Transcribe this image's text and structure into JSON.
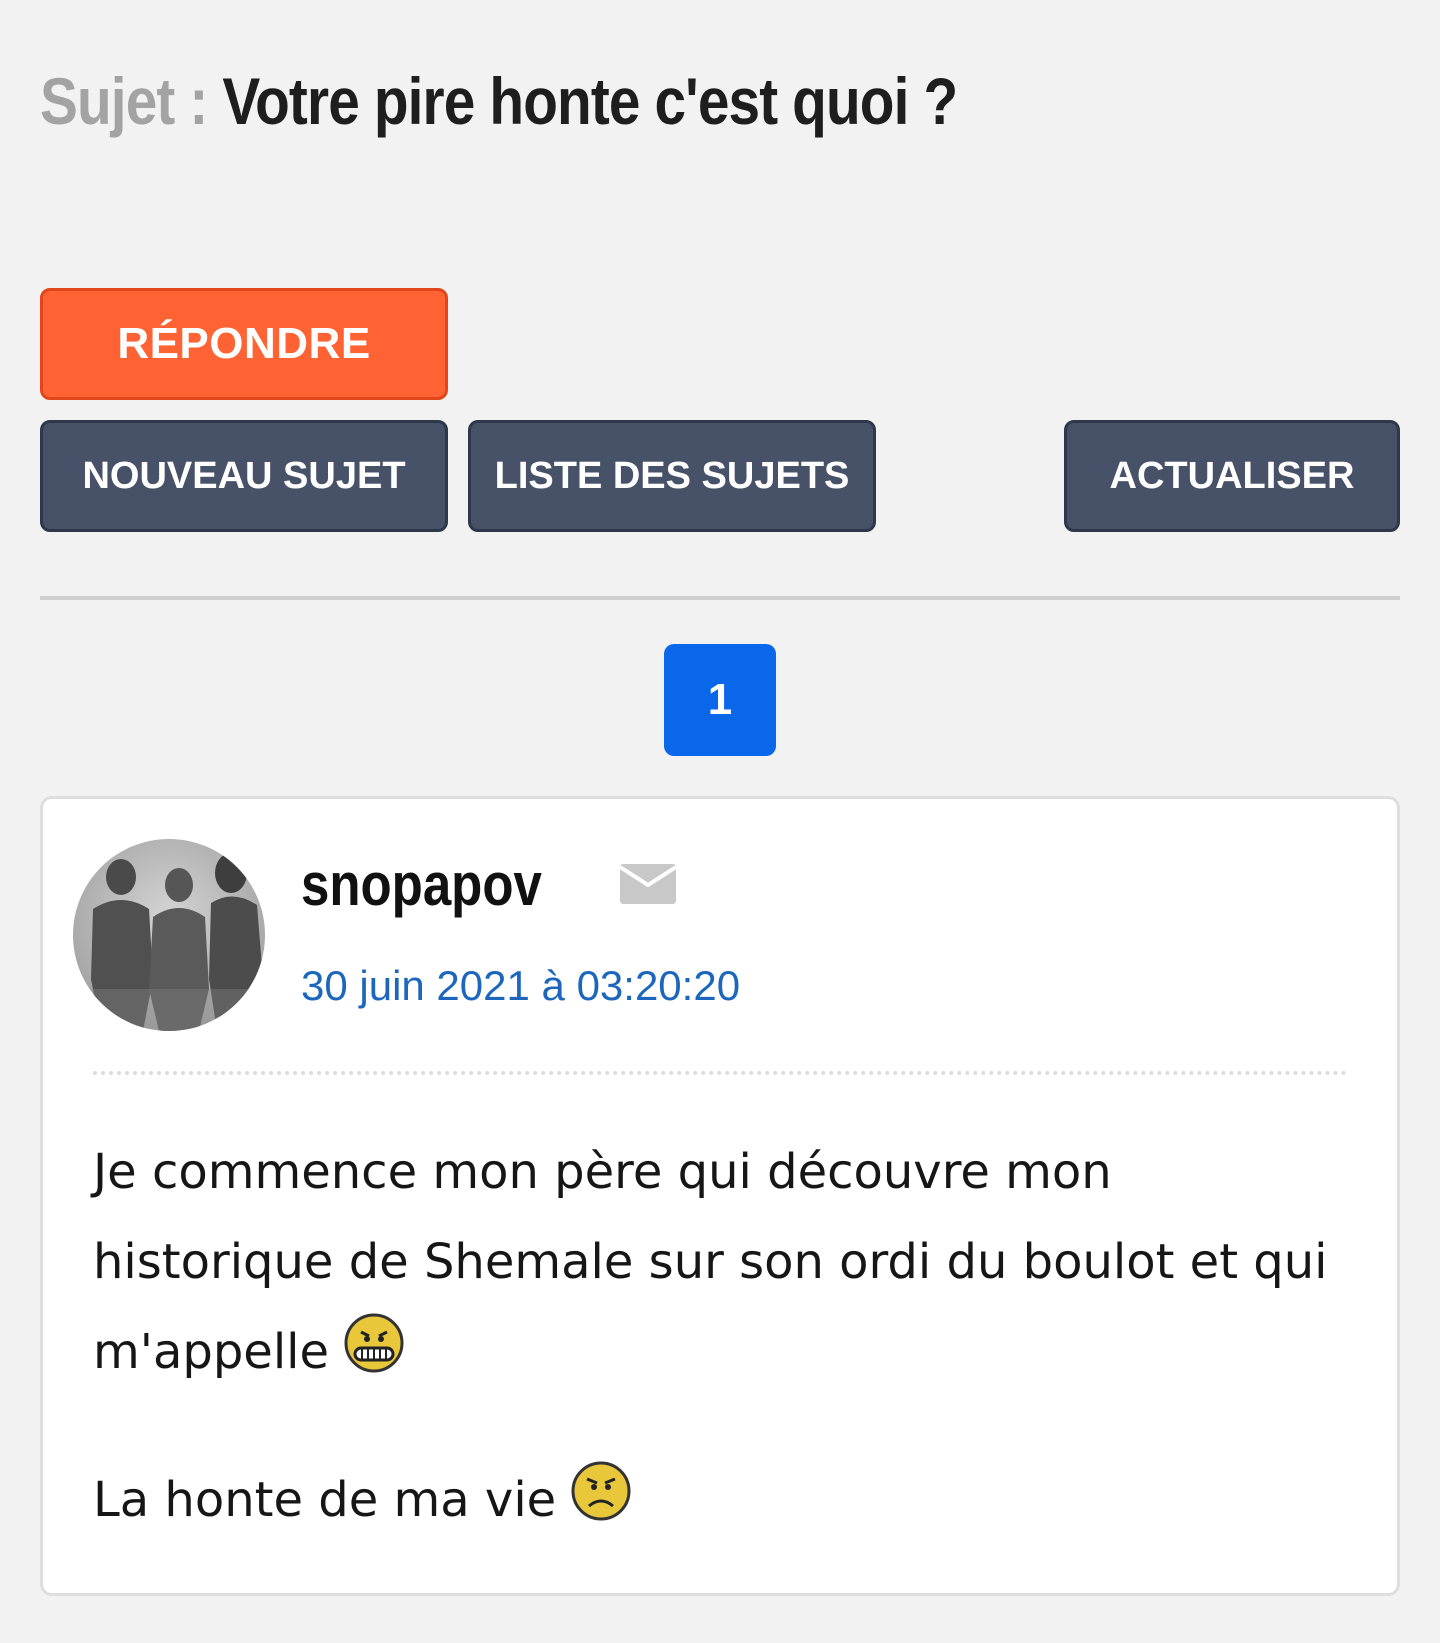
{
  "topic": {
    "prefix": "Sujet : ",
    "title": "Votre pire honte c'est quoi ?"
  },
  "actions": {
    "reply_label": "RÉPONDRE",
    "new_topic_label": "NOUVEAU SUJET",
    "topic_list_label": "LISTE DES SUJETS",
    "refresh_label": "ACTUALISER"
  },
  "pagination": {
    "current_page": "1"
  },
  "post": {
    "author": "snopapov",
    "date": "30 juin 2021 à 03:20:20",
    "paragraphs": [
      "Je commence mon père qui découvre mon historique de Shemale sur son ordi du boulot et qui m'appelle",
      "La honte de ma vie"
    ],
    "icons": {
      "avatar": "avatar-silhouettes-image",
      "mail": "mail-icon",
      "smiley_1": "nervous-smiley-icon",
      "smiley_2": "sad-smiley-icon"
    }
  },
  "colors": {
    "background": "#f2f2f2",
    "reply_button": "#ff6333",
    "secondary_button": "#475269",
    "page_active": "#0b67ea",
    "date_link": "#1c67bd",
    "title_prefix": "#a3a3a3"
  }
}
